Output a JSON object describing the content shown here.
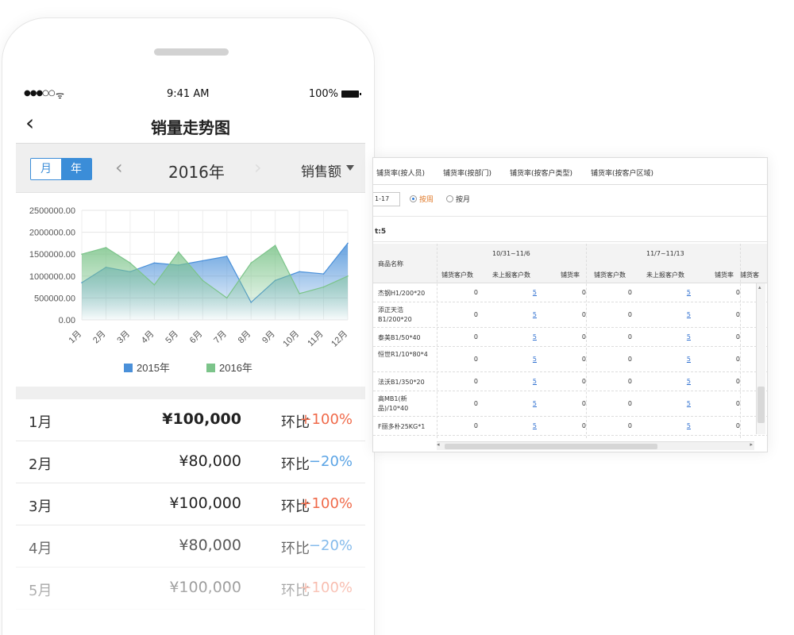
{
  "mobile": {
    "status": {
      "signal": "●●●○○",
      "wifi": "ᯤ",
      "time": "9:41 AM",
      "battery": "100%"
    },
    "nav": {
      "title": "销量走势图"
    },
    "toolbar": {
      "segments": [
        "月",
        "年"
      ],
      "active_segment": "年",
      "year": "2016年",
      "metric": "销售额"
    },
    "chart_data": {
      "type": "area",
      "categories": [
        "1月",
        "2月",
        "3月",
        "4月",
        "5月",
        "6月",
        "7月",
        "8月",
        "9月",
        "10月",
        "11月",
        "12月"
      ],
      "series": [
        {
          "name": "2015年",
          "color": "#4a90d9",
          "values": [
            850000,
            1200000,
            1100000,
            1300000,
            1250000,
            1350000,
            1450000,
            400000,
            900000,
            1100000,
            1050000,
            1750000
          ]
        },
        {
          "name": "2016年",
          "color": "#7cc48a",
          "values": [
            1500000,
            1650000,
            1300000,
            800000,
            1550000,
            900000,
            500000,
            1300000,
            1700000,
            600000,
            750000,
            1000000
          ]
        }
      ],
      "yticks": [
        "2500000.00",
        "2000000.00",
        "1500000.00",
        "1000000.00",
        "500000.00",
        "0.00"
      ],
      "ylim": [
        0,
        2500000
      ],
      "legend": "bottom",
      "grid": true
    },
    "list": [
      {
        "month": "1月",
        "amount": "¥100,000",
        "ratio_label": "环比",
        "ratio": "+100%",
        "trend": "up"
      },
      {
        "month": "2月",
        "amount": "¥80,000",
        "ratio_label": "环比",
        "ratio": "−20%",
        "trend": "down"
      },
      {
        "month": "3月",
        "amount": "¥100,000",
        "ratio_label": "环比",
        "ratio": "+100%",
        "trend": "up"
      },
      {
        "month": "4月",
        "amount": "¥80,000",
        "ratio_label": "环比",
        "ratio": "−20%",
        "trend": "down"
      },
      {
        "month": "5月",
        "amount": "¥100,000",
        "ratio_label": "环比",
        "ratio": "+100%",
        "trend": "up"
      }
    ]
  },
  "desktop": {
    "tabs": [
      "铺货率(按人员)",
      "铺货率(按部门)",
      "铺货率(按客户类型)",
      "铺货率(按客户区域)"
    ],
    "date_value": "1-17",
    "radios": [
      {
        "label": "按周",
        "selected": true
      },
      {
        "label": "按月",
        "selected": false
      }
    ],
    "section_label": "t:5",
    "table": {
      "name_header": "商品名称",
      "groups": [
        "10/31~11/6",
        "11/7~11/13"
      ],
      "subheaders": [
        "铺货客户数",
        "未上报客户数",
        "铺货率",
        "铺货客户数",
        "未上报客户数",
        "铺货率",
        "铺货客"
      ],
      "rows": [
        {
          "name": "杰钢H1/200*20",
          "cells": [
            "0",
            "5",
            "0",
            "0",
            "5",
            "0"
          ]
        },
        {
          "name": "添正天浩B1/200*20",
          "cells": [
            "0",
            "5",
            "0",
            "0",
            "5",
            "0"
          ]
        },
        {
          "name": "泰美B1/50*40",
          "cells": [
            "0",
            "5",
            "0",
            "0",
            "5",
            "0"
          ]
        },
        {
          "name": "恒世R1/10*80*4",
          "cells": [
            "0",
            "5",
            "0",
            "0",
            "5",
            "0"
          ]
        },
        {
          "name": "法沃B1/350*20",
          "cells": [
            "0",
            "5",
            "0",
            "0",
            "5",
            "0"
          ]
        },
        {
          "name": "高MB1(新品)/10*40",
          "cells": [
            "0",
            "5",
            "0",
            "0",
            "5",
            "0"
          ]
        },
        {
          "name": "F丽多朴25KG*1",
          "cells": [
            "0",
            "5",
            "0",
            "0",
            "5",
            "0"
          ]
        }
      ]
    },
    "scrollbar": {
      "left_arrow": "◂",
      "right_arrow": "▸",
      "up_arrow": "▴",
      "grip": "≡",
      "mid_grip": "|||"
    }
  }
}
